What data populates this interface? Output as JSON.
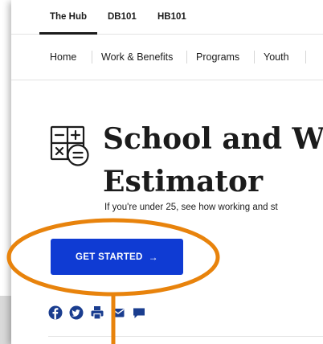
{
  "top_tabs": [
    {
      "label": "The Hub",
      "active": true
    },
    {
      "label": "DB101",
      "active": false
    },
    {
      "label": "HB101",
      "active": false
    }
  ],
  "nav_items": [
    "Home",
    "Work & Benefits",
    "Programs",
    "Youth"
  ],
  "hero": {
    "title_line1": "School and W",
    "title_line2": "Estimator",
    "subtitle": "If you're under 25, see how working and st"
  },
  "cta": {
    "label": "GET STARTED",
    "arrow": "→"
  },
  "share_icons": [
    "facebook-icon",
    "twitter-icon",
    "print-icon",
    "email-icon",
    "chat-icon"
  ],
  "colors": {
    "accent": "#0f3bd3",
    "highlight": "#e8830c",
    "text": "#1b1b1b",
    "icons": "#1a3d8f"
  }
}
